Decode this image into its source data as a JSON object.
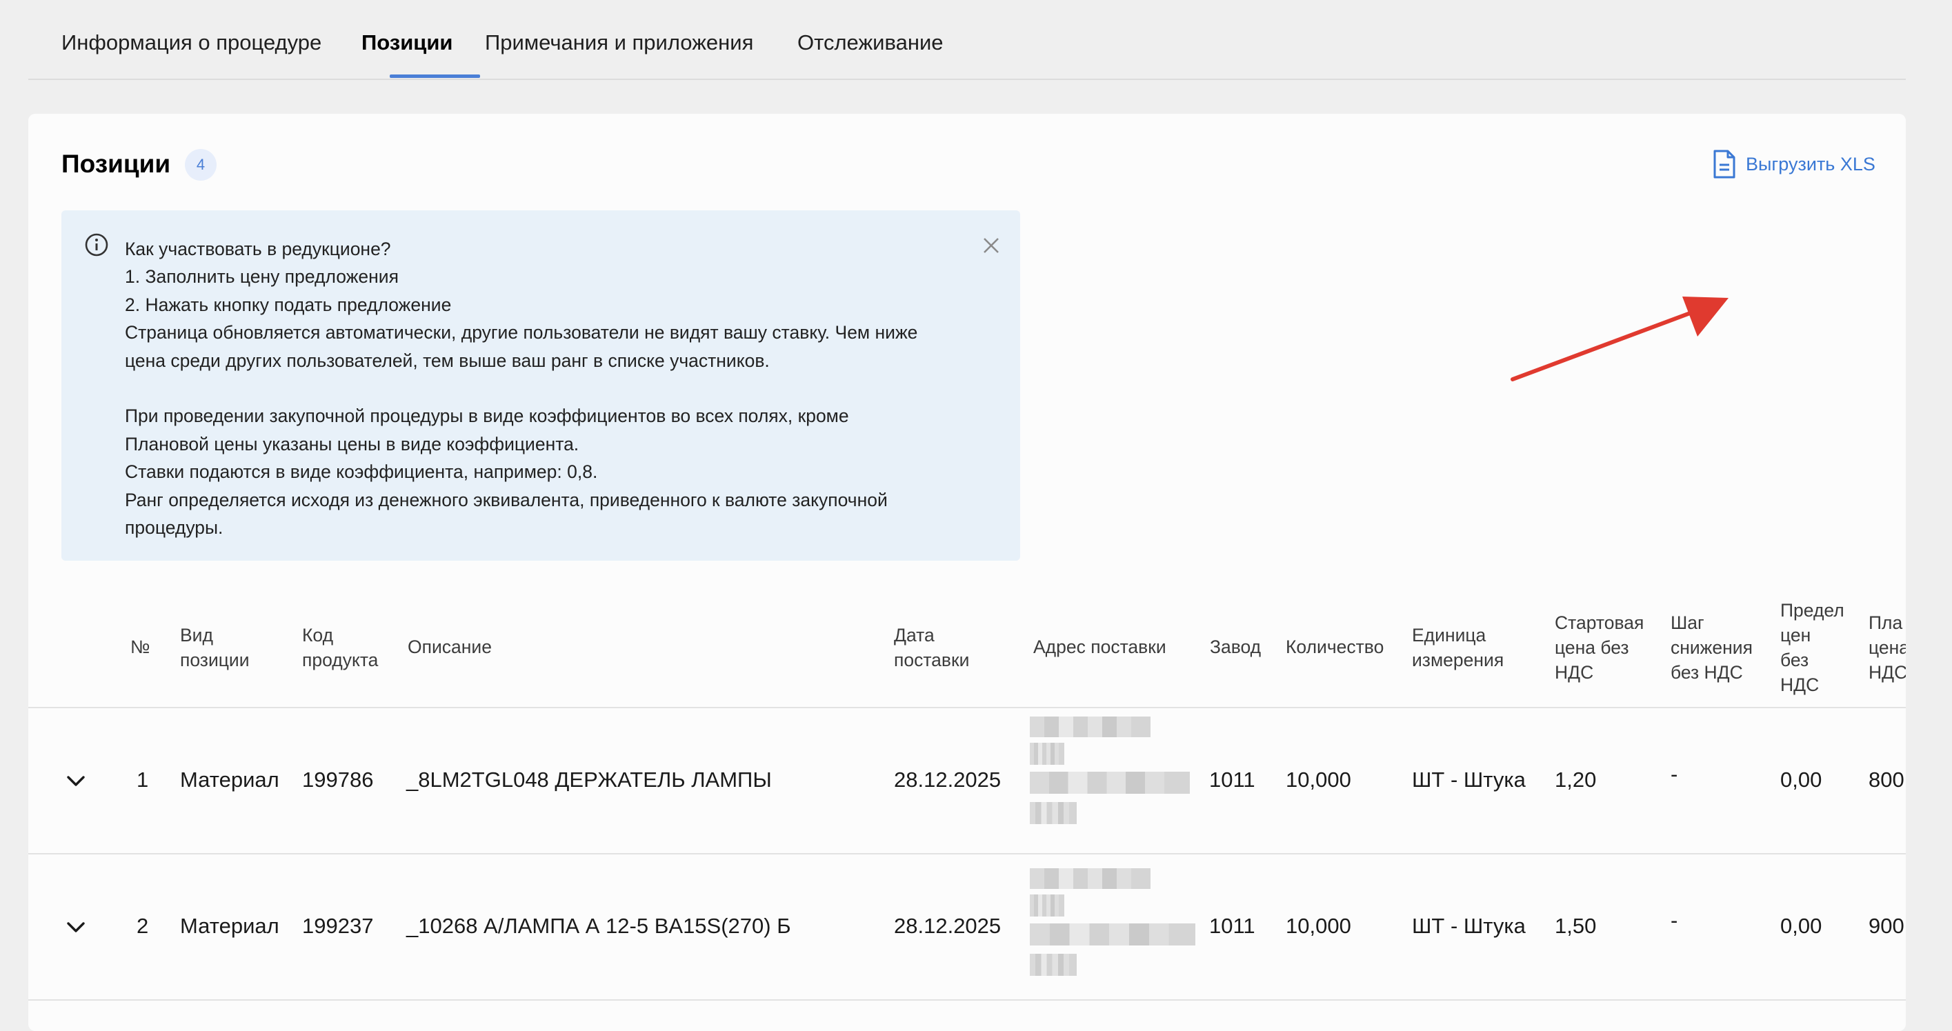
{
  "tabs": [
    {
      "label": "Информация о процедуре",
      "active": false
    },
    {
      "label": "Позиции",
      "active": true
    },
    {
      "label": "Примечания и приложения",
      "active": false
    },
    {
      "label": "Отслеживание",
      "active": false
    }
  ],
  "section": {
    "title": "Позиции",
    "count": "4",
    "export_label": "Выгрузить XLS"
  },
  "info": {
    "lines": [
      "Как участвовать в редукционе?",
      "1. Заполнить цену предложения",
      "2. Нажать кнопку подать предложение",
      "Страница обновляется автоматически, другие пользователи не видят вашу ставку. Чем ниже",
      "цена среди других пользователей, тем выше ваш ранг в списке участников.",
      "",
      "При проведении закупочной процедуры в виде коэффициентов во всех полях, кроме",
      "Плановой цены указаны цены в виде коэффициента.",
      "Ставки подаются в виде коэффициента, например: 0,8.",
      "Ранг определяется исходя из денежного эквивалента, приведенного к валюте закупочной",
      "процедуры."
    ]
  },
  "table": {
    "headers": [
      "№",
      "Вид\nпозиции",
      "Код\nпродукта",
      "Описание",
      "Дата\nпоставки",
      "Адрес поставки",
      "Завод",
      "Количество",
      "Единица\nизмерения",
      "Стартовая\nцена без\nНДС",
      "Шаг\nснижения\nбез НДС",
      "Предел\nцен\nбез\nНДС",
      "Пла\nцена\nНДС"
    ],
    "rows": [
      {
        "num": "1",
        "type": "Материал",
        "code": "199786",
        "description": "_8LM2TGL048 ДЕРЖАТЕЛЬ ЛАМПЫ",
        "date": "28.12.2025",
        "plant": "1011",
        "qty": "10,000",
        "unit": "ШТ - Штука",
        "start_price": "1,20",
        "step": "-",
        "limit": "0,00",
        "plan": "800"
      },
      {
        "num": "2",
        "type": "Материал",
        "code": "199237",
        "description": "_10268 А/ЛАМПА А 12-5 BA15S(270) Б",
        "date": "28.12.2025",
        "plant": "1011",
        "qty": "10,000",
        "unit": "ШТ - Штука",
        "start_price": "1,50",
        "step": "-",
        "limit": "0,00",
        "plan": "900"
      }
    ]
  },
  "colors": {
    "accent": "#4a7fd6",
    "link": "#3a78d4",
    "info_bg": "#e8f1f9",
    "arrow": "#e03a2f",
    "page_bg": "#efefef"
  },
  "icons": [
    "document-icon",
    "info-icon",
    "close-icon",
    "chevron-down-icon",
    "arrow-annotation"
  ]
}
